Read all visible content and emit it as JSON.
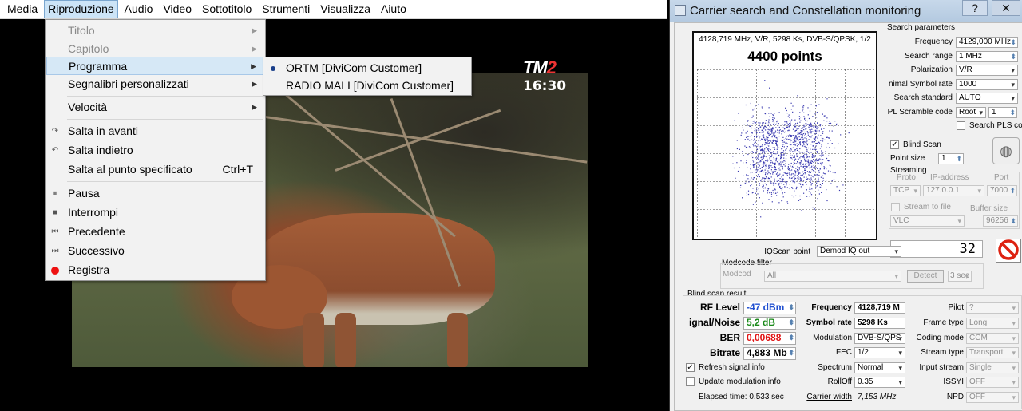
{
  "vlc": {
    "menubar": [
      "Media",
      "Riproduzione",
      "Audio",
      "Video",
      "Sottotitolo",
      "Strumenti",
      "Visualizza",
      "Aiuto"
    ],
    "active_menu": "Riproduzione",
    "overlay_logo": "TM",
    "overlay_logo_2": "2",
    "overlay_time": "16:30",
    "menu": {
      "titolo": "Titolo",
      "capitolo": "Capitolo",
      "programma": "Programma",
      "segnalibri": "Segnalibri personalizzati",
      "velocita": "Velocità",
      "avanti": "Salta in avanti",
      "indietro": "Salta indietro",
      "punto": "Salta al punto specificato",
      "punto_shortcut": "Ctrl+T",
      "pausa": "Pausa",
      "interrompi": "Interrompi",
      "precedente": "Precedente",
      "successivo": "Successivo",
      "registra": "Registra"
    },
    "submenu": [
      "ORTM [DiviCom Customer]",
      "RADIO MALI [DiviCom Customer]"
    ]
  },
  "dialog": {
    "title": "Carrier search and Constellation monitoring",
    "help_btn": "?",
    "close_btn": "✕",
    "plot": {
      "info": "4128,719 MHz, V/R, 5298 Ks, DVB-S/QPSK, 1/2",
      "points": "4400 points"
    },
    "search_params": {
      "header": "Search parameters",
      "frequency_label": "Frequency",
      "frequency": "4129,000 MHz",
      "range_label": "Search range",
      "range": "1 MHz",
      "pol_label": "Polarization",
      "pol": "V/R",
      "minsym_label": "nimal Symbol rate",
      "minsym": "1000",
      "standard_label": "Search standard",
      "standard": "AUTO",
      "pls_label": "PL Scramble code",
      "pls_mode": "Root",
      "pls_val": "1",
      "search_pls": "Search PLS co"
    },
    "blind_scan": "Blind Scan",
    "point_size_label": "Point size",
    "point_size": "1",
    "streaming": {
      "header": "Streaming",
      "proto_label": "Proto",
      "ip_label": "IP-address",
      "port_label": "Port",
      "proto": "TCP",
      "ip": "127.0.0.1",
      "port": "7000",
      "stream_file": "Stream to file",
      "buffer_label": "Buffer size",
      "player": "VLC",
      "buffer": "96256"
    },
    "counter": "32",
    "iqscan_label": "IQScan point",
    "iqscan": "Demod IQ out",
    "modcode": {
      "header": "Modcode filter",
      "label": "Modcod",
      "value": "All",
      "detect": "Detect",
      "time": "3 sec"
    },
    "result": {
      "header": "Blind scan result",
      "rf_label": "RF Level",
      "rf": "-47 dBm",
      "sn_label": "ignal/Noise",
      "sn": "5,2 dB",
      "ber_label": "BER",
      "ber": "0,00688",
      "bitrate_label": "Bitrate",
      "bitrate": "4,883 Mb",
      "freq_label": "Frequency",
      "freq": "4128,719 M",
      "sym_label": "Symbol rate",
      "sym": "5298 Ks",
      "mod_label": "Modulation",
      "mod": "DVB-S/QPS",
      "fec_label": "FEC",
      "fec": "1/2",
      "spectrum_label": "Spectrum",
      "spectrum": "Normal",
      "rolloff_label": "RollOff",
      "rolloff": "0.35",
      "cw_label": "Carrier width",
      "cw": "7,153 MHz",
      "pilot_label": "Pilot",
      "pilot": "?",
      "frame_label": "Frame type",
      "frame": "Long",
      "coding_label": "Coding mode",
      "coding": "CCM",
      "stype_label": "Stream type",
      "stype": "Transport",
      "istream_label": "Input stream",
      "istream": "Single",
      "issyi_label": "ISSYI",
      "issyi": "OFF",
      "npd_label": "NPD",
      "npd": "OFF",
      "refresh": "Refresh signal info",
      "update": "Update modulation info",
      "elapsed": "Elapsed time: 0.533 sec"
    },
    "colors": {
      "rf": "#1f4fd0",
      "sn": "#1a8a1a",
      "ber": "#e01515"
    }
  }
}
